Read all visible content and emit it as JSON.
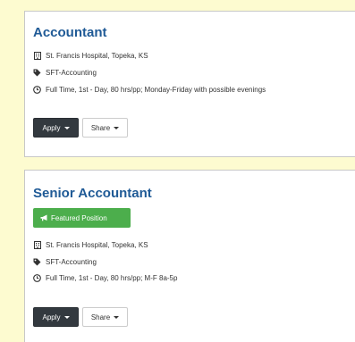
{
  "jobs": [
    {
      "title": "Accountant",
      "featured": null,
      "location": "St. Francis Hospital, Topeka, KS",
      "department": "SFT-Accounting",
      "schedule": "Full Time, 1st - Day, 80 hrs/pp; Monday-Friday with possible evenings",
      "apply_label": "Apply",
      "share_label": "Share"
    },
    {
      "title": "Senior Accountant",
      "featured": "Featured Position",
      "location": "St. Francis Hospital, Topeka, KS",
      "department": "SFT-Accounting",
      "schedule": "Full Time, 1st - Day, 80 hrs/pp; M-F 8a-5p",
      "apply_label": "Apply",
      "share_label": "Share"
    }
  ],
  "icons": {
    "location": "building-icon",
    "department": "tag-icon",
    "schedule": "clock-icon",
    "featured": "bullhorn-icon",
    "dropdown": "caret-down-icon"
  },
  "colors": {
    "page_background": "#fdfbd0",
    "title": "#1f5a96",
    "featured_badge": "#4cae4c",
    "apply_button": "#33393f"
  }
}
